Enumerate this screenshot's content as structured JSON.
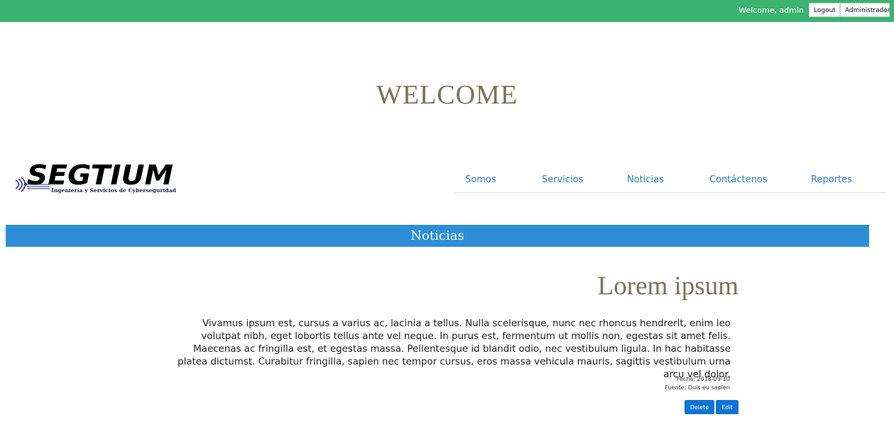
{
  "topbar": {
    "welcome_text": "Welcome, admin",
    "logout_label": "Logout",
    "admin_label": "Administrador",
    "color": "#3cb371"
  },
  "hero": {
    "title": "WELCOME"
  },
  "logo": {
    "name": "SEGTIUM",
    "tagline": "Ingeniería y Servicios de Cyberseguridad"
  },
  "nav": {
    "items": [
      {
        "label": "Somos"
      },
      {
        "label": "Servicios"
      },
      {
        "label": "Noticias"
      },
      {
        "label": "Contáctenos"
      },
      {
        "label": "Reportes"
      }
    ]
  },
  "section": {
    "title": "Noticias",
    "color": "#2d8ed8"
  },
  "article": {
    "title": "Lorem ipsum",
    "body": "Vivamus ipsum est, cursus a varius ac, lacinia a tellus. Nulla scelerisque, nunc nec rhoncus hendrerit, enim leo volutpat nibh, eget lobortis tellus ante vel neque. In purus est, fermentum ut mollis non, egestas sit amet felis. Maecenas ac fringilla est, et egestas massa. Pellentesque id blandit odio, nec vestibulum ligula. In hac habitasse platea dictumst. Curabitur fringilla, sapien nec tempor cursus, eros massa vehicula mauris, sagittis vestibulum urna arcu vel dolor.",
    "fecha": "Fecha: 2018-09-10",
    "fuente": "Fuente: Duis eu sapien",
    "delete_label": "Delete",
    "edit_label": "Edit"
  }
}
